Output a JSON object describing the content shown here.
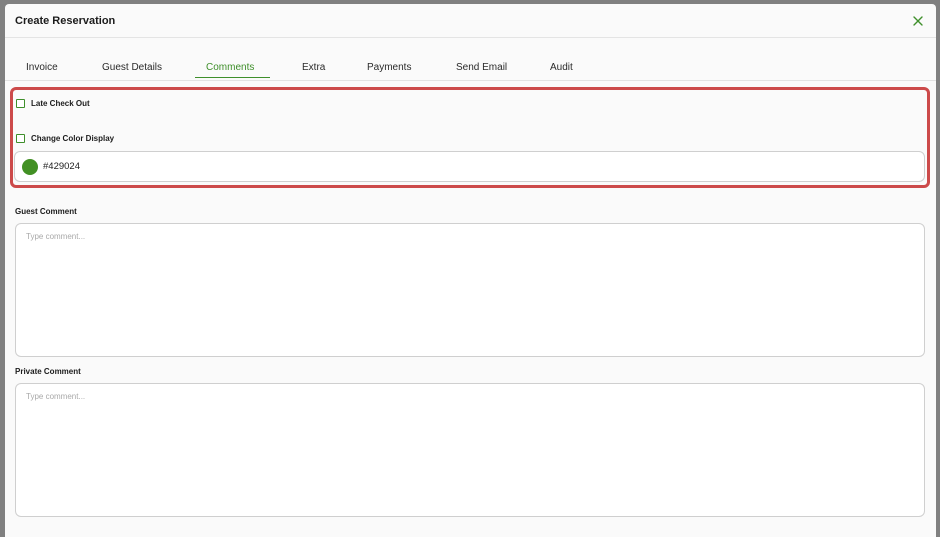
{
  "modal": {
    "title": "Create Reservation",
    "close_glyph": "X"
  },
  "tabs": [
    {
      "label": "Invoice",
      "active": false
    },
    {
      "label": "Guest Details",
      "active": false
    },
    {
      "label": "Comments",
      "active": true
    },
    {
      "label": "Extra",
      "active": false
    },
    {
      "label": "Payments",
      "active": false
    },
    {
      "label": "Send Email",
      "active": false
    },
    {
      "label": "Audit",
      "active": false
    }
  ],
  "options": {
    "late_checkout_label": "Late Check Out",
    "late_checkout_checked": false,
    "change_color_label": "Change Color Display",
    "change_color_checked": false,
    "color_value": "#429024"
  },
  "comments": {
    "guest_label": "Guest Comment",
    "guest_placeholder": "Type comment...",
    "private_label": "Private Comment",
    "private_placeholder": "Type comment..."
  },
  "colors": {
    "accent": "#3f8f2b",
    "highlight": "#cc4a4a",
    "swatch": "#429024"
  }
}
